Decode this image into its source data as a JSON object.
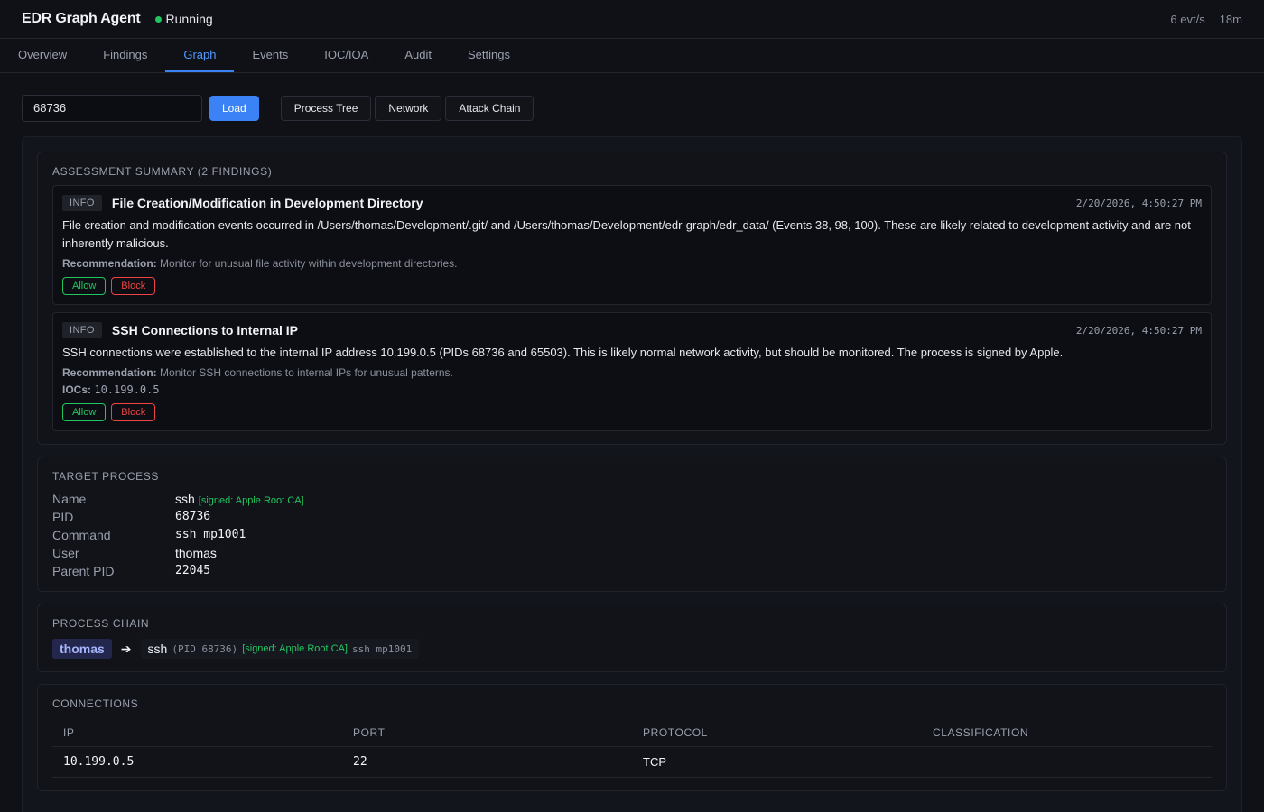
{
  "header": {
    "title": "EDR Graph Agent",
    "status": "Running",
    "rate": "6 evt/s",
    "uptime": "18m"
  },
  "tabs": [
    {
      "label": "Overview"
    },
    {
      "label": "Findings"
    },
    {
      "label": "Graph",
      "active": true
    },
    {
      "label": "Events"
    },
    {
      "label": "IOC/IOA"
    },
    {
      "label": "Audit"
    },
    {
      "label": "Settings"
    }
  ],
  "toolbar": {
    "pid_value": "68736",
    "load_label": "Load",
    "views": [
      "Process Tree",
      "Network",
      "Attack Chain"
    ]
  },
  "assessment": {
    "title": "ASSESSMENT SUMMARY (2 FINDINGS)",
    "findings": [
      {
        "severity": "INFO",
        "title": "File Creation/Modification in Development Directory",
        "time": "2/20/2026, 4:50:27 PM",
        "description": "File creation and modification events occurred in /Users/thomas/Development/.git/ and /Users/thomas/Development/edr-graph/edr_data/ (Events 38, 98, 100). These are likely related to development activity and are not inherently malicious.",
        "rec_label": "Recommendation:",
        "recommendation": "Monitor for unusual file activity within development directories.",
        "allow": "Allow",
        "block": "Block"
      },
      {
        "severity": "INFO",
        "title": "SSH Connections to Internal IP",
        "time": "2/20/2026, 4:50:27 PM",
        "description": "SSH connections were established to the internal IP address 10.199.0.5 (PIDs 68736 and 65503). This is likely normal network activity, but should be monitored. The process is signed by Apple.",
        "rec_label": "Recommendation:",
        "recommendation": "Monitor SSH connections to internal IPs for unusual patterns.",
        "iocs_label": "IOCs:",
        "iocs": "10.199.0.5",
        "allow": "Allow",
        "block": "Block"
      }
    ]
  },
  "target": {
    "title": "TARGET PROCESS",
    "name_label": "Name",
    "name": "ssh",
    "signed": "[signed: Apple Root CA]",
    "pid_label": "PID",
    "pid": "68736",
    "command_label": "Command",
    "command": "ssh mp1001",
    "user_label": "User",
    "user": "thomas",
    "parent_label": "Parent PID",
    "parent_pid": "22045"
  },
  "chain": {
    "title": "PROCESS CHAIN",
    "user": "thomas",
    "arrow": "➔",
    "proc": "ssh",
    "pid": "(PID 68736)",
    "signed": "[signed: Apple Root CA]",
    "cmd": "ssh mp1001"
  },
  "connections": {
    "title": "CONNECTIONS",
    "columns": [
      "IP",
      "PORT",
      "PROTOCOL",
      "CLASSIFICATION"
    ],
    "rows": [
      {
        "ip": "10.199.0.5",
        "port": "22",
        "protocol": "TCP",
        "classification": ""
      }
    ]
  }
}
